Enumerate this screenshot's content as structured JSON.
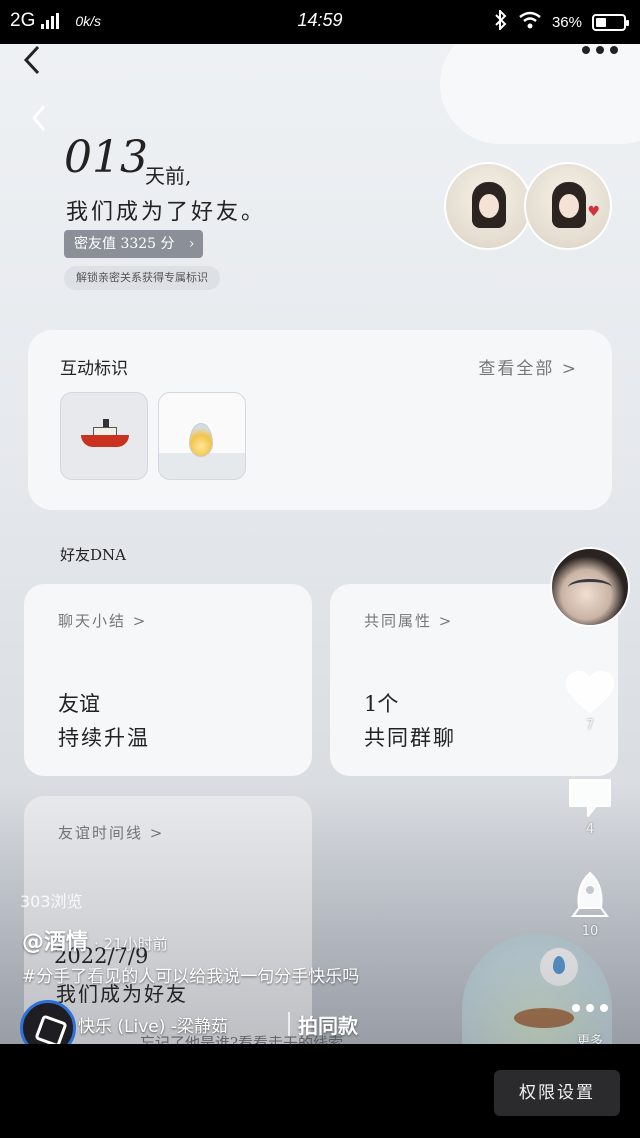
{
  "status_bar": {
    "network": "2G",
    "speed": "0k/s",
    "time": "14:59",
    "battery": "36%"
  },
  "video": {
    "days_number": "013",
    "days_unit": "天前,",
    "became_friends": "我们成为了好友。",
    "intimacy": "密友值 3325 分",
    "unlock_hint": "解锁亲密关系获得专属标识",
    "interact_title": "互动标识",
    "view_all": "查看全部 >",
    "dna_title": "好友DNA",
    "chat_summary_title": "聊天小结 >",
    "chat_summary_line1": "友谊",
    "chat_summary_line2": "持续升温",
    "common_title": "共同属性 >",
    "common_line1": "1个",
    "common_line2": "共同群聊",
    "timeline_title": "友谊时间线 >",
    "bottom_partial_text": "忘记了他是谁?看看走干的线索"
  },
  "overlay": {
    "views": "303浏览",
    "author": "@酒情",
    "time_ago": "· 21小时前",
    "date": "2022/7/9",
    "friend_text": "我们成为好友",
    "caption": "#分手了看见的人可以给我说一句分手快乐吗",
    "music": "快乐 (Live) -梁静茹",
    "same_style": "拍同款"
  },
  "rail": {
    "likes": "7",
    "comments": "4",
    "shares": "10",
    "more": "更多"
  },
  "bottom": {
    "permission_button": "权限设置"
  },
  "icons": [
    "back-icon",
    "more-icon",
    "heart-icon",
    "comment-icon",
    "share-icon",
    "ship-icon",
    "flame-icon",
    "music-disc-icon"
  ],
  "colors": {
    "accent_red": "#f2375a",
    "disc_ring": "#2f6fd8"
  }
}
